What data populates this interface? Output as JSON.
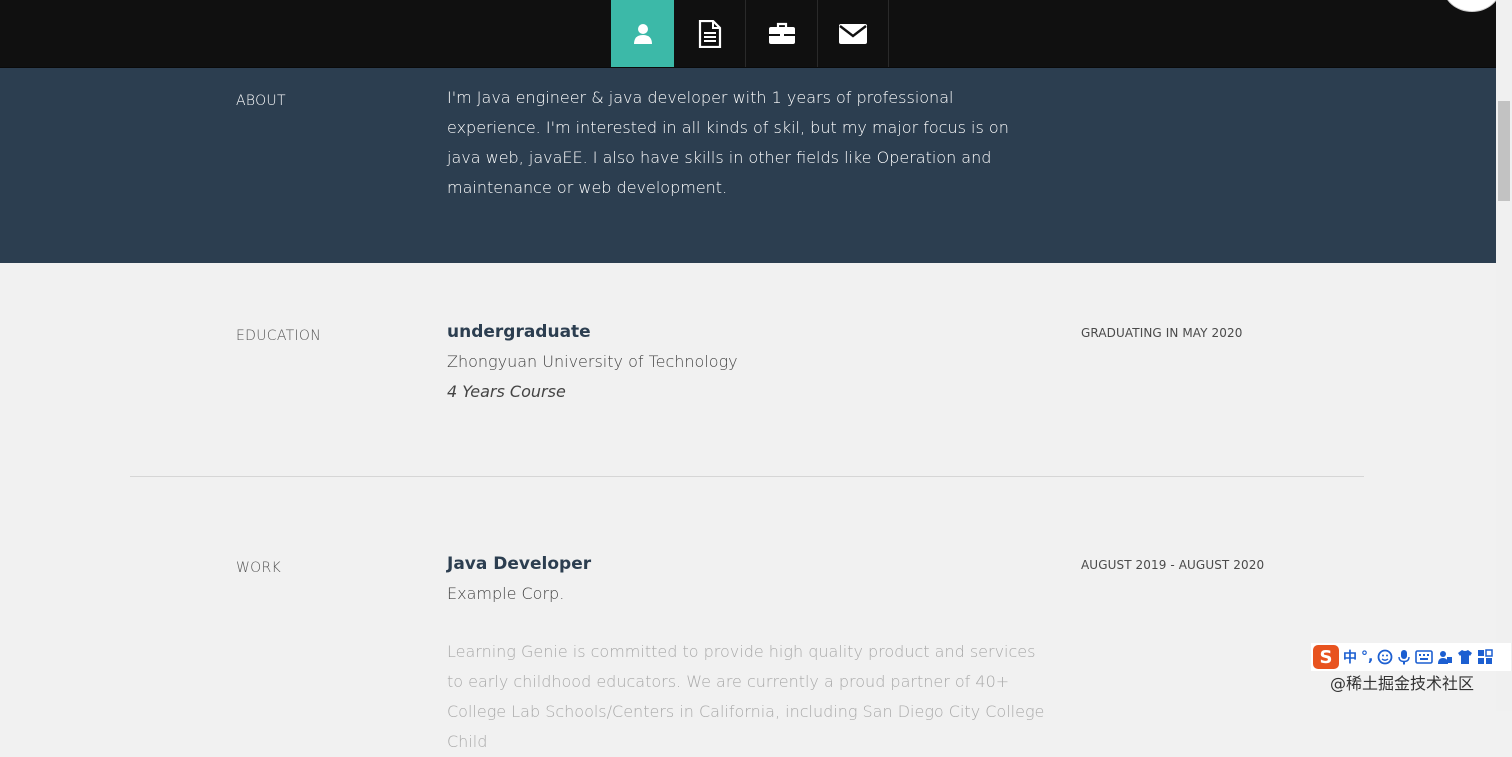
{
  "nav": {
    "icons": [
      "user-icon",
      "document-icon",
      "briefcase-icon",
      "envelope-icon"
    ],
    "active_color": "#3cb9a8"
  },
  "about": {
    "label": "ABOUT",
    "text": "I'm Java engineer & java developer with 1 years of professional experience. I'm interested in all kinds of skil, but my major focus is on java web, javaEE. I also have skills in other fields like Operation and maintenance or web development."
  },
  "education": {
    "label": "EDUCATION",
    "title": "undergraduate",
    "school": "Zhongyuan University of Technology",
    "course": "4 Years Course",
    "date": "GRADUATING IN MAY 2020"
  },
  "work": {
    "label": "WORK",
    "title": "Java Developer",
    "company": "Example Corp.",
    "date": "AUGUST 2019 - AUGUST 2020",
    "description": "Learning Genie is committed to provide high quality product and services to early childhood educators. We are currently a proud partner of 40+ College Lab Schools/Centers in California, including San Diego City College Child"
  },
  "ime": {
    "logo": "S",
    "mode": "中",
    "punct": "°,",
    "icons": [
      "emoji-icon",
      "microphone-icon",
      "keyboard-icon",
      "user-group-icon",
      "shirt-icon",
      "grid-icon"
    ]
  },
  "watermark": "@稀土掘金技术社区"
}
